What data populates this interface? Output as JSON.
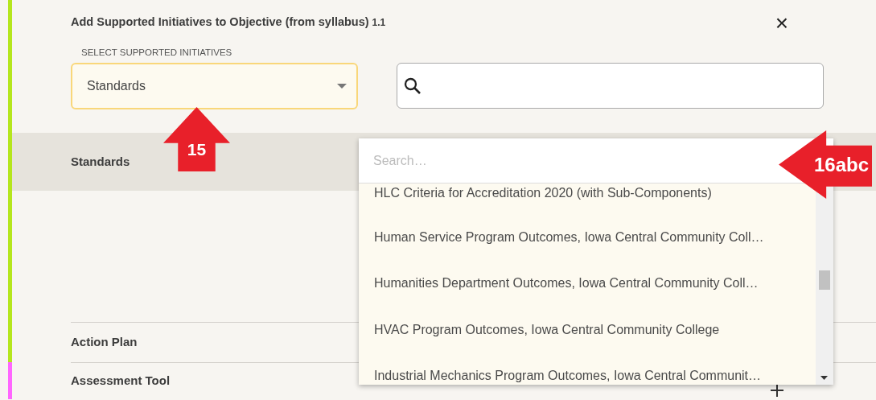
{
  "dialog": {
    "title": "Add Supported Initiatives to Objective (from syllabus)",
    "title_number": "1.1",
    "close": "×"
  },
  "select": {
    "label": "SELECT SUPPORTED INITIATIVES",
    "value": "Standards",
    "open": true
  },
  "groups": [
    {
      "color": "#b5e61d",
      "rows": [
        {
          "title": "Standards",
          "selected": true,
          "add_button": false
        },
        {
          "title": "Action Plan",
          "selected": false,
          "add_button": false
        }
      ]
    },
    {
      "color": "#ff66ff",
      "rows": [
        {
          "title": "Assessment Tool",
          "selected": false,
          "add_button": true
        }
      ]
    }
  ],
  "dropdown": {
    "placeholder": "Search…",
    "options": [
      {
        "label": "HLC Criteria for Accreditation 2020 (with Sub-Components)"
      },
      {
        "label": "Human Service Program Outcomes, Iowa Central Community Coll…"
      },
      {
        "label": "Humanities Department Outcomes, Iowa Central Community Coll…"
      },
      {
        "label": "HVAC Program Outcomes, Iowa Central Community College"
      },
      {
        "label": "Industrial Mechanics Program Outcomes, Iowa Central Communit…"
      }
    ]
  },
  "annotations": [
    {
      "label": "15",
      "kind": "up"
    },
    {
      "label": "16abc",
      "kind": "left"
    }
  ]
}
